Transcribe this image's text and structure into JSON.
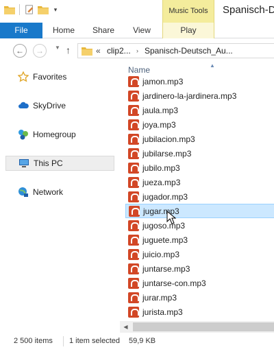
{
  "titlebar": {
    "title": "Spanisch-D",
    "contextual_tab": "Music Tools"
  },
  "ribbon": {
    "tabs": [
      "File",
      "Home",
      "Share",
      "View",
      "Play"
    ]
  },
  "address": {
    "chevron": "«",
    "crumbs": [
      "clip2...",
      "Spanisch-Deutsch_Au..."
    ]
  },
  "nav": {
    "items": [
      {
        "label": "Favorites",
        "icon": "star-icon"
      },
      {
        "label": "SkyDrive",
        "icon": "cloud-icon"
      },
      {
        "label": "Homegroup",
        "icon": "homegroup-icon"
      },
      {
        "label": "This PC",
        "icon": "computer-icon"
      },
      {
        "label": "Network",
        "icon": "network-icon"
      }
    ]
  },
  "filelist": {
    "column_header": "Name",
    "files": [
      "jamon.mp3",
      "jardinero-la-jardinera.mp3",
      "jaula.mp3",
      "joya.mp3",
      "jubilacion.mp3",
      "jubilarse.mp3",
      "jubilo.mp3",
      "jueza.mp3",
      "jugador.mp3",
      "jugar.mp3",
      "jugoso.mp3",
      "juguete.mp3",
      "juicio.mp3",
      "juntarse.mp3",
      "juntarse-con.mp3",
      "jurar.mp3",
      "jurista.mp3"
    ],
    "selected": "jugar.mp3"
  },
  "status": {
    "item_count": "2 500 items",
    "selection": "1 item selected",
    "size": "59,9 KB"
  },
  "colors": {
    "file_tab": "#1979ca",
    "contextual_tab": "#f4ec9c",
    "selection": "#cce8ff"
  }
}
